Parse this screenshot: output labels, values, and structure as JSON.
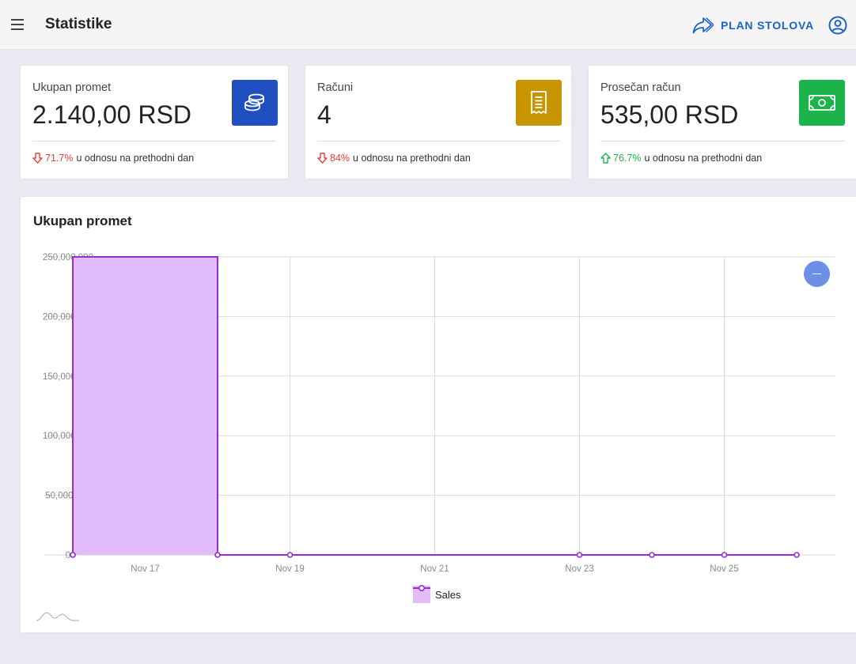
{
  "header": {
    "title": "Statistike",
    "plan_label": "PLAN STOLOVA",
    "accent": "#1a63c5"
  },
  "cards": [
    {
      "label": "Ukupan promet",
      "value": "2.140,00 RSD",
      "icon": "coins-icon",
      "icon_color": "#1f4fc1",
      "trend": "down",
      "trend_color": "#e0453b",
      "change": "71.7%",
      "change_text": "u odnosu na prethodni dan"
    },
    {
      "label": "Računi",
      "value": "4",
      "icon": "receipt-icon",
      "icon_color": "#c69500",
      "trend": "down",
      "trend_color": "#e0453b",
      "change": "84%",
      "change_text": "u odnosu na prethodni dan"
    },
    {
      "label": "Prosečan račun",
      "value": "535,00 RSD",
      "icon": "banknote-icon",
      "icon_color": "#1cb34b",
      "trend": "up",
      "trend_color": "#1cb34b",
      "change": "76.7%",
      "change_text": "u odnosu na prethodni dan"
    }
  ],
  "chart": {
    "title": "Ukupan promet"
  },
  "chart_data": {
    "type": "area",
    "title": "Ukupan promet",
    "xlabel": "",
    "ylabel": "",
    "x": [
      "Nov 16",
      "Nov 18",
      "Nov 19",
      "Nov 23",
      "Nov 24",
      "Nov 25",
      "Nov 26"
    ],
    "series": [
      {
        "name": "Sales",
        "values": [
          250000000,
          0,
          0,
          0,
          0,
          0,
          0
        ],
        "color": "#9b2bd0",
        "fill": "#e3bcfb"
      }
    ],
    "x_ticks": [
      "Nov 17",
      "Nov 19",
      "Nov 21",
      "Nov 23",
      "Nov 25"
    ],
    "y_ticks": [
      "0",
      "50,000,000",
      "100,000,000",
      "150,000,000",
      "200,000,000",
      "250,000,000"
    ],
    "y_tick_values": [
      0,
      50000000,
      100000000,
      150000000,
      200000000,
      250000000
    ],
    "ylim": [
      0,
      250000000
    ],
    "grid": true,
    "legend_position": "bottom-center"
  }
}
